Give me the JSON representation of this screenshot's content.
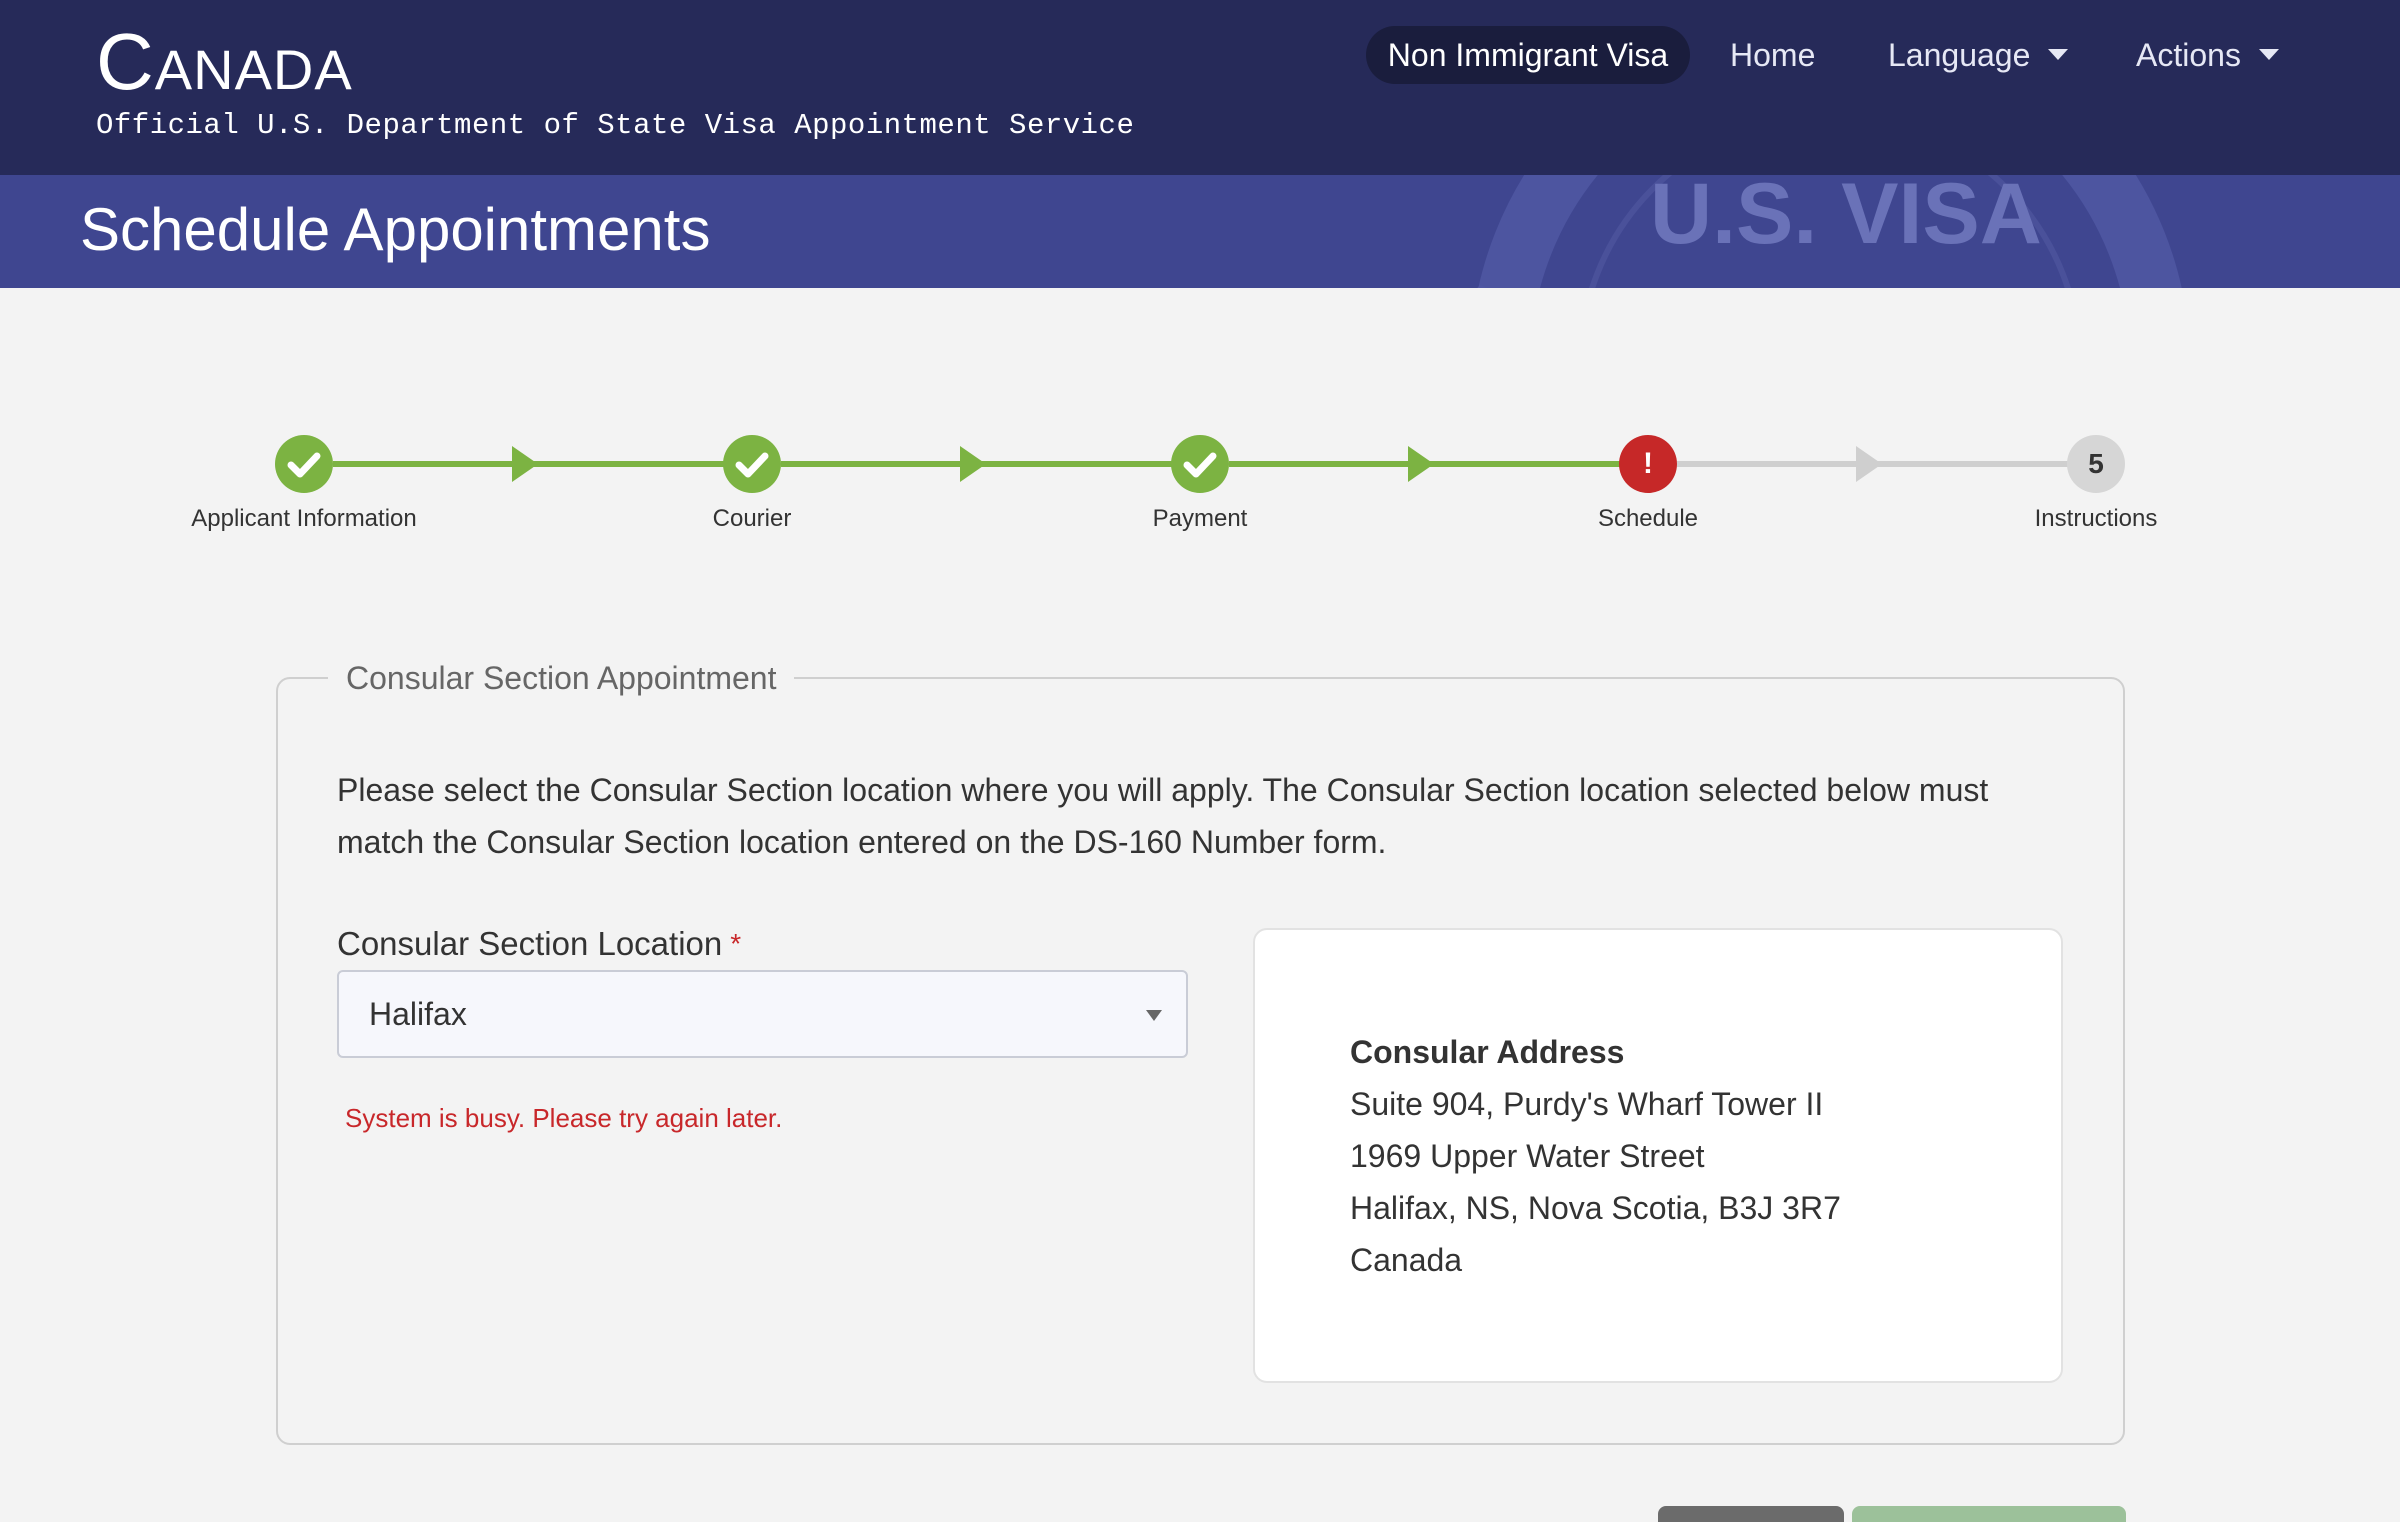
{
  "header": {
    "brand_title": "Canada",
    "brand_subtitle": "Official U.S. Department of State Visa Appointment Service",
    "nav": {
      "active": "Non Immigrant Visa",
      "home": "Home",
      "language": "Language",
      "actions": "Actions"
    }
  },
  "banner": {
    "title": "Schedule Appointments",
    "seal_text": "U.S. VISA"
  },
  "stepper": {
    "steps": [
      {
        "label": "Applicant Information",
        "state": "complete",
        "marker": "✓"
      },
      {
        "label": "Courier",
        "state": "complete",
        "marker": "✓"
      },
      {
        "label": "Payment",
        "state": "complete",
        "marker": "✓"
      },
      {
        "label": "Schedule",
        "state": "error",
        "marker": "!"
      },
      {
        "label": "Instructions",
        "state": "pending",
        "marker": "5"
      }
    ]
  },
  "appointment": {
    "legend": "Consular Section Appointment",
    "intro": "Please select the Consular Section location where you will apply. The Consular Section location selected below must match the Consular Section location entered on the DS-160 Number form.",
    "location_label": "Consular Section Location",
    "required_mark": "*",
    "location_value": "Halifax",
    "error_message": "System is busy. Please try again later.",
    "address": {
      "title": "Consular Address",
      "lines": [
        "Suite 904, Purdy's Wharf Tower II",
        "1969 Upper Water Street",
        "Halifax, NS, Nova Scotia, B3J 3R7",
        "Canada"
      ]
    }
  },
  "colors": {
    "header_bg": "#262a59",
    "banner_bg": "#3f4690",
    "complete": "#7cb342",
    "error": "#c62828",
    "pending": "#cfcfcf"
  }
}
